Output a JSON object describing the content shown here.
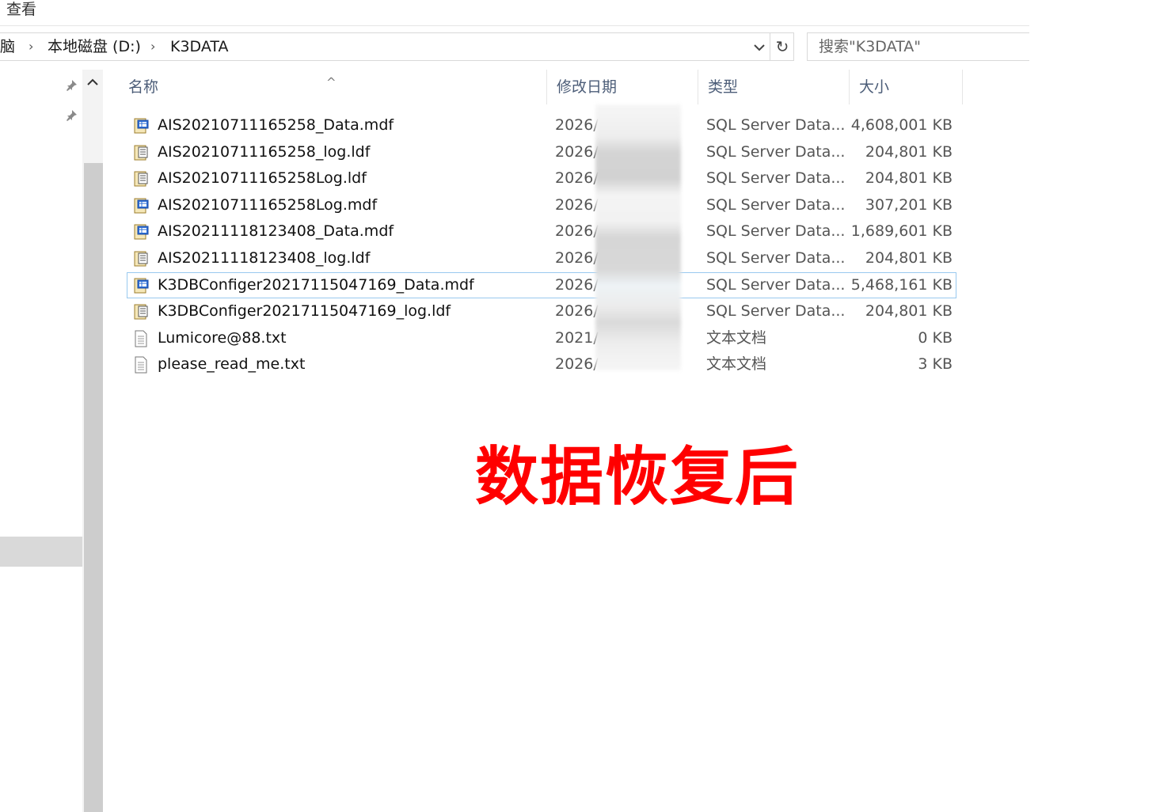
{
  "ribbon": {
    "tab_view": "查看"
  },
  "address": {
    "crumbs": [
      "脑",
      "本地磁盘 (D:)",
      "K3DATA"
    ],
    "dropdown_icon": "chevron-down-icon",
    "refresh_icon": "refresh-icon"
  },
  "search": {
    "placeholder": "搜索\"K3DATA\""
  },
  "columns": {
    "name": "名称",
    "date": "修改日期",
    "type": "类型",
    "size": "大小"
  },
  "files": [
    {
      "name": "AIS20210711165258_Data.mdf",
      "date": "2026/",
      "type": "SQL Server Data...",
      "size": "4,608,001 KB",
      "icon": "mdf-file-icon"
    },
    {
      "name": "AIS20210711165258_log.ldf",
      "date": "2026/",
      "type": "SQL Server Data...",
      "size": "204,801 KB",
      "icon": "ldf-file-icon"
    },
    {
      "name": "AIS20210711165258Log.ldf",
      "date": "2026/",
      "type": "SQL Server Data...",
      "size": "204,801 KB",
      "icon": "ldf-file-icon"
    },
    {
      "name": "AIS20210711165258Log.mdf",
      "date": "2026/",
      "type": "SQL Server Data...",
      "size": "307,201 KB",
      "icon": "mdf-file-icon"
    },
    {
      "name": "AIS20211118123408_Data.mdf",
      "date": "2026/",
      "type": "SQL Server Data...",
      "size": "1,689,601 KB",
      "icon": "mdf-file-icon"
    },
    {
      "name": "AIS20211118123408_log.ldf",
      "date": "2026/",
      "type": "SQL Server Data...",
      "size": "204,801 KB",
      "icon": "ldf-file-icon"
    },
    {
      "name": "K3DBConfiger20217115047169_Data.mdf",
      "date": "2026/",
      "type": "SQL Server Data...",
      "size": "5,468,161 KB",
      "icon": "mdf-file-icon",
      "selected": true
    },
    {
      "name": "K3DBConfiger20217115047169_log.ldf",
      "date": "2026/",
      "type": "SQL Server Data...",
      "size": "204,801 KB",
      "icon": "ldf-file-icon"
    },
    {
      "name": "Lumicore@88.txt",
      "date": "2021/",
      "type": "文本文档",
      "size": "0 KB",
      "icon": "text-file-icon"
    },
    {
      "name": "please_read_me.txt",
      "date": "2026/",
      "type": "文本文档",
      "size": "3 KB",
      "icon": "text-file-icon"
    }
  ],
  "overlay": {
    "caption": "数据恢复后",
    "color": "#ff0000"
  }
}
